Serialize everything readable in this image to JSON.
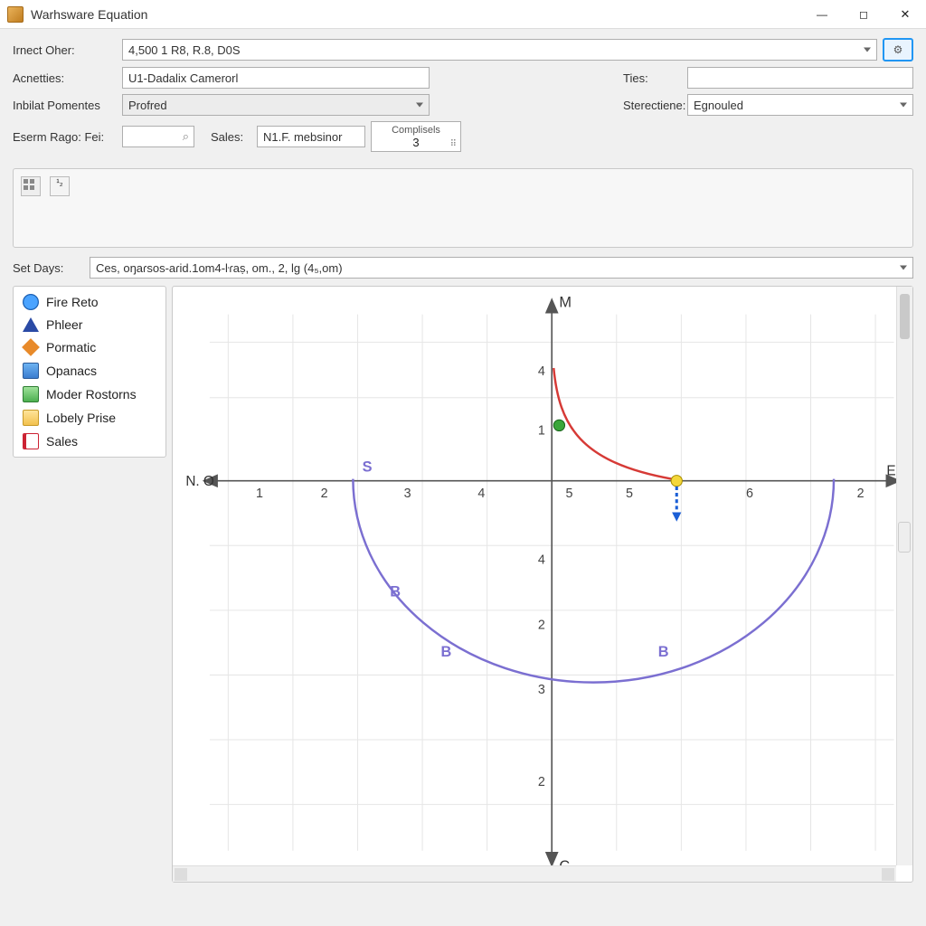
{
  "window": {
    "title": "Warhsware Equation",
    "minimize": "minimize",
    "maximize": "maximize",
    "close": "close"
  },
  "form": {
    "irnect_oher_label": "Irnect Oher:",
    "irnect_oher_value": "4,500 1 R8, R.8, D0S",
    "acnetties_label": "Acnetties:",
    "acnetties_value": "U1-Dadalix Camerorl",
    "ties_label": "Ties:",
    "ties_value": "",
    "inbilat_label": "Inbilat Pomentes",
    "inbilat_value": "Profred",
    "sterectiene_label": "Sterectiene:",
    "sterectiene_value": "Egnouled",
    "eserm_label": "Eserm Rago: Fei:",
    "eserm_value": "",
    "sales_label": "Sales:",
    "sales_value": "N1.F. mebsinor",
    "complisels_label": "Complisels",
    "complisels_value": "3"
  },
  "setdays": {
    "label": "Set Days:",
    "value": "Ces, oŋaɾsos-aɾid.1om4-ŀɾaṣ, om., 2, lg (4₅,om)"
  },
  "sidebar": {
    "items": [
      {
        "icon": "globe-icon",
        "label": "Fire Reto"
      },
      {
        "icon": "triangle-icon",
        "label": "Phleer"
      },
      {
        "icon": "diamond-icon",
        "label": "Pormatic"
      },
      {
        "icon": "disk-icon",
        "label": "Opanacs"
      },
      {
        "icon": "chart-icon",
        "label": "Moder Rostorns"
      },
      {
        "icon": "folder-icon",
        "label": "Lobely Prise"
      },
      {
        "icon": "doc-icon",
        "label": "Sales"
      }
    ]
  },
  "chart_data": {
    "type": "diagram",
    "axes": {
      "top_label": "M",
      "bottom_label": "C",
      "left_label": "N. O",
      "right_label": "Ea",
      "x_ticks_left": [
        "1",
        "2",
        "3",
        "4"
      ],
      "x_ticks_right": [
        "5",
        "5",
        "6",
        "2"
      ],
      "y_ticks_top": [
        "4",
        "1"
      ],
      "y_ticks_bottom": [
        "4",
        "2",
        "3",
        "2"
      ]
    },
    "curves": [
      {
        "name": "purple-arc",
        "color": "#7b6fd1",
        "type": "arc",
        "center": [
          5,
          0
        ],
        "radius": 3.1,
        "start_deg": 180,
        "end_deg": 360,
        "point_labels": [
          {
            "tag": "S",
            "at": [
              2.7,
              0.2
            ]
          },
          {
            "tag": "B",
            "at": [
              3.3,
              -1.8
            ]
          },
          {
            "tag": "B",
            "at": [
              3.8,
              -2.5
            ]
          },
          {
            "tag": "B",
            "at": [
              6.4,
              -2.5
            ]
          }
        ]
      },
      {
        "name": "red-curve",
        "color": "#d63a36",
        "type": "curve",
        "points": [
          [
            5,
            3.7
          ],
          [
            5.2,
            1.4
          ],
          [
            5.9,
            0.4
          ],
          [
            6.5,
            0.05
          ]
        ]
      }
    ],
    "markers": [
      {
        "name": "green-dot",
        "color": "#3aa63a",
        "at": [
          5.05,
          1.4
        ]
      },
      {
        "name": "yellow-dot",
        "color": "#e6c200",
        "at": [
          6.5,
          0
        ]
      },
      {
        "name": "blue-stub",
        "color": "#1b5fd6",
        "from": [
          6.5,
          0
        ],
        "to": [
          6.5,
          -0.6
        ]
      }
    ]
  },
  "colors": {
    "accent": "#2196f3",
    "red": "#d63a36",
    "purple": "#7b6fd1",
    "green": "#3aa63a",
    "yellow": "#e6c200",
    "blue": "#1b5fd6"
  }
}
